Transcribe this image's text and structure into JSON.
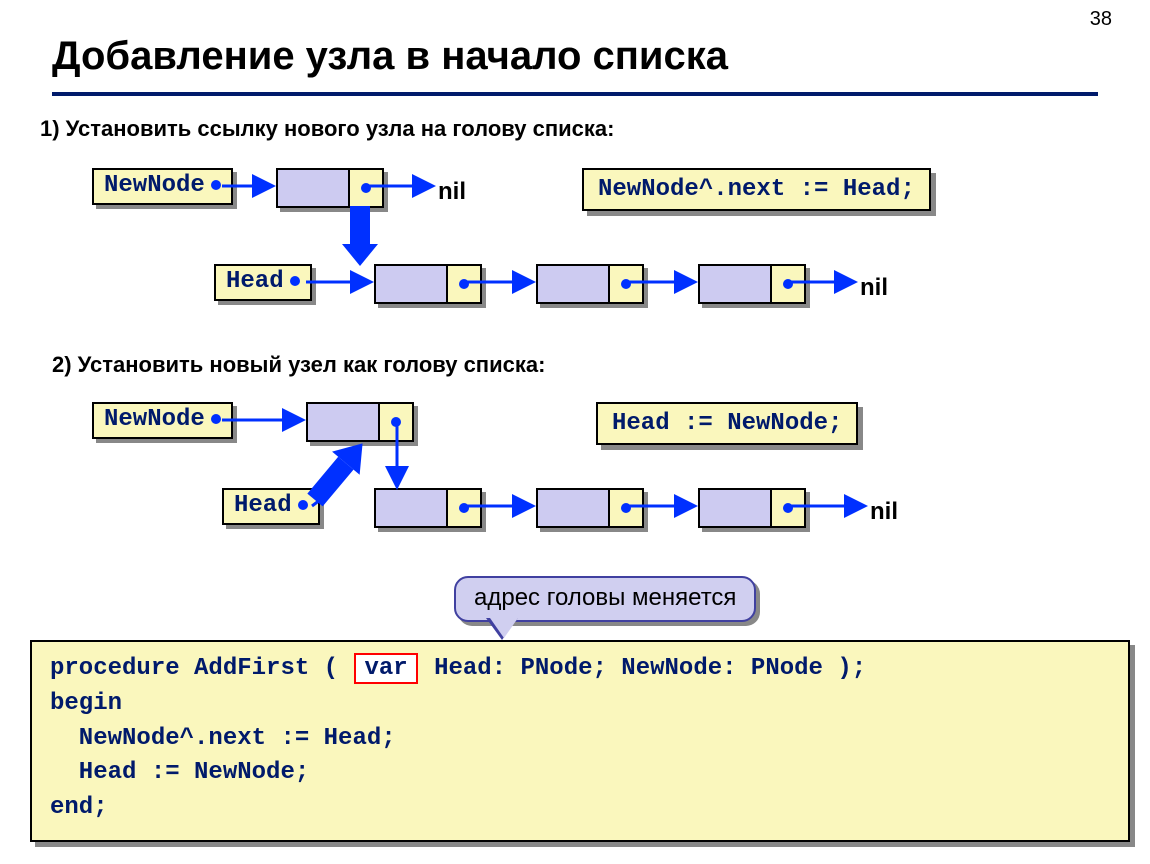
{
  "page_number": "38",
  "title": "Добавление узла в начало списка",
  "step1_heading": "1) Установить ссылку нового узла на голову списка:",
  "step2_heading": "2) Установить новый узел как голову списка:",
  "labels": {
    "newnode": "NewNode",
    "head": "Head",
    "nil": "nil"
  },
  "code": {
    "line1": "NewNode^.next := Head;",
    "line2": "Head := NewNode;",
    "proc": "procedure AddFirst ( ",
    "proc_var": "var",
    "proc_rest": " Head: PNode; NewNode: PNode );",
    "begin": "begin",
    "body1": "  NewNode^.next := Head;",
    "body2": "  Head := NewNode;",
    "end": "end;"
  },
  "callout": "адрес головы меняется"
}
